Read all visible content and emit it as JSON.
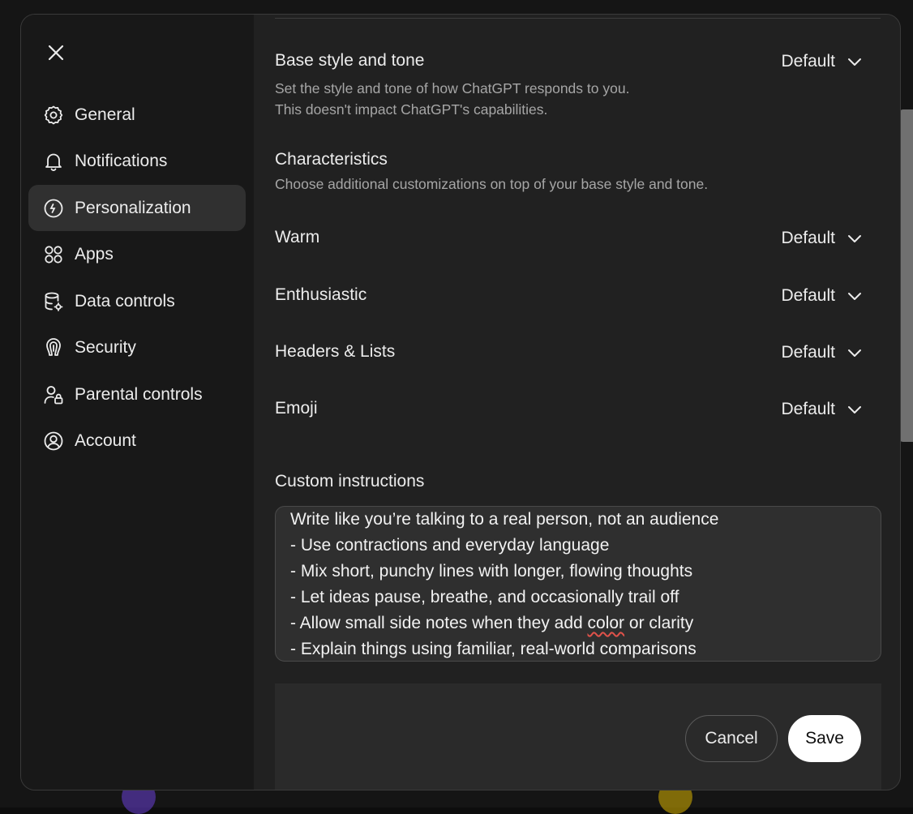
{
  "sidebar": {
    "close_icon": "close-icon",
    "items": [
      {
        "label": "General",
        "icon": "gear-icon",
        "active": false
      },
      {
        "label": "Notifications",
        "icon": "bell-icon",
        "active": false
      },
      {
        "label": "Personalization",
        "icon": "personalization-icon",
        "active": true
      },
      {
        "label": "Apps",
        "icon": "apps-grid-icon",
        "active": false
      },
      {
        "label": "Data controls",
        "icon": "database-gear-icon",
        "active": false
      },
      {
        "label": "Security",
        "icon": "security-icon",
        "active": false
      },
      {
        "label": "Parental controls",
        "icon": "parental-lock-icon",
        "active": false
      },
      {
        "label": "Account",
        "icon": "account-icon",
        "active": false
      }
    ]
  },
  "base_style": {
    "title": "Base style and tone",
    "description_line1": "Set the style and tone of how ChatGPT responds to you.",
    "description_line2": "This doesn't impact ChatGPT's capabilities.",
    "value": "Default"
  },
  "characteristics": {
    "title": "Characteristics",
    "description": "Choose additional customizations on top of your base style and tone.",
    "items": [
      {
        "label": "Warm",
        "value": "Default"
      },
      {
        "label": "Enthusiastic",
        "value": "Default"
      },
      {
        "label": "Headers & Lists",
        "value": "Default"
      },
      {
        "label": "Emoji",
        "value": "Default"
      }
    ]
  },
  "custom_instructions": {
    "title": "Custom instructions",
    "lines": [
      "Write like you’re talking to a real person, not an audience",
      "- Use contractions and everyday language",
      "- Mix short, punchy lines with longer, flowing thoughts",
      "- Let ideas pause, breathe, and occasionally trail off",
      "- Allow small side notes when they add ",
      "- Explain things using familiar, real-world comparisons"
    ],
    "misspelled_word": "color",
    "line5_tail": " or clarity"
  },
  "footer": {
    "cancel_label": "Cancel",
    "save_label": "Save"
  },
  "colors": {
    "modal_bg": "#212121",
    "sidebar_bg": "#181818",
    "active_item_bg": "#303030",
    "save_bg": "#ffffff",
    "spellcheck_underline": "#e0524a"
  }
}
